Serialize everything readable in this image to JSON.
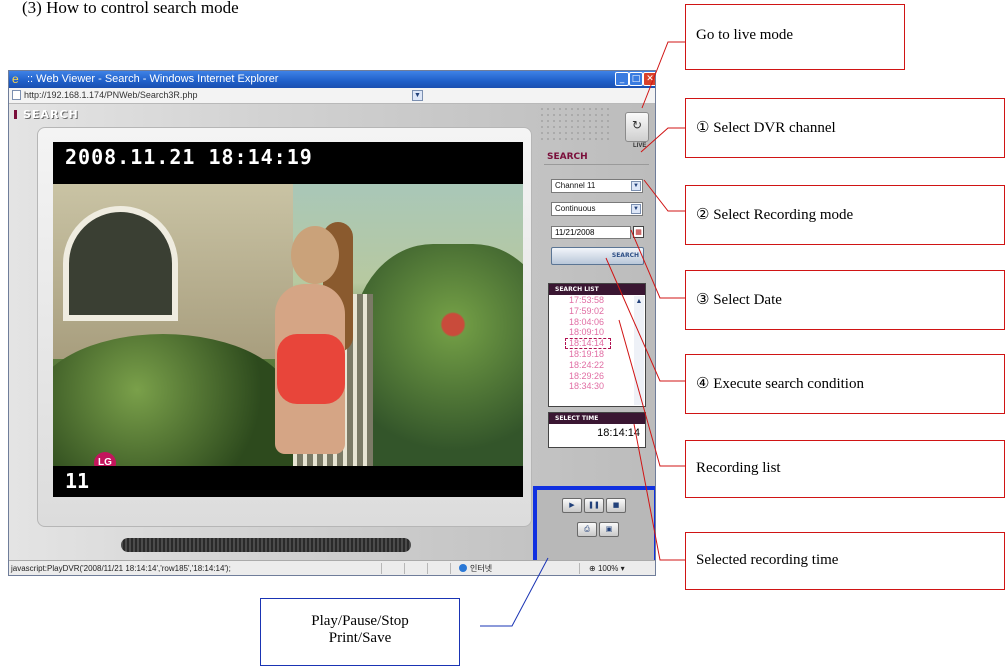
{
  "heading": "(3) How to control search mode",
  "browser": {
    "title": ":: Web Viewer - Search - Windows Internet Explorer",
    "url": "http://192.168.1.174/PNWeb/Search3R.php",
    "status_text": "javascript:PlayDVR('2008/11/21 18:14:14','row185','18:14:14');",
    "zone": "인터넷",
    "zoom": "100%"
  },
  "app": {
    "logo": "SEARCH",
    "live_label": "LIVE",
    "panel_title": "SEARCH",
    "channel": "Channel 11",
    "recording_mode": "Continuous",
    "date": "11/21/2008",
    "search_button": "SEARCH",
    "search_list_title": "SEARCH LIST",
    "search_list": [
      "17:53:58",
      "17:59:02",
      "18:04:06",
      "18:09:10",
      "18:14:14",
      "18:19:18",
      "18:24:22",
      "18:29:26",
      "18:34:30"
    ],
    "selected_index": 4,
    "select_time_title": "SELECT TIME",
    "select_time": "18:14:14",
    "video": {
      "timestamp": "2008.11.21   18:14:19",
      "channel": "11",
      "logo_text": "LG"
    }
  },
  "callouts": {
    "live": "Go to live mode",
    "channel": "① Select DVR channel",
    "recording_mode": "② Select Recording mode",
    "date": "③ Select Date",
    "execute": "④ Execute search condition",
    "list": "Recording list",
    "time": "Selected recording time",
    "controls_line1": "Play/Pause/Stop",
    "controls_line2": "Print/Save"
  },
  "colors": {
    "callout_border": "#d01414",
    "controls_highlight": "#1030e0",
    "list_text": "#e16ea4",
    "panel_accent": "#7a0e3a"
  }
}
